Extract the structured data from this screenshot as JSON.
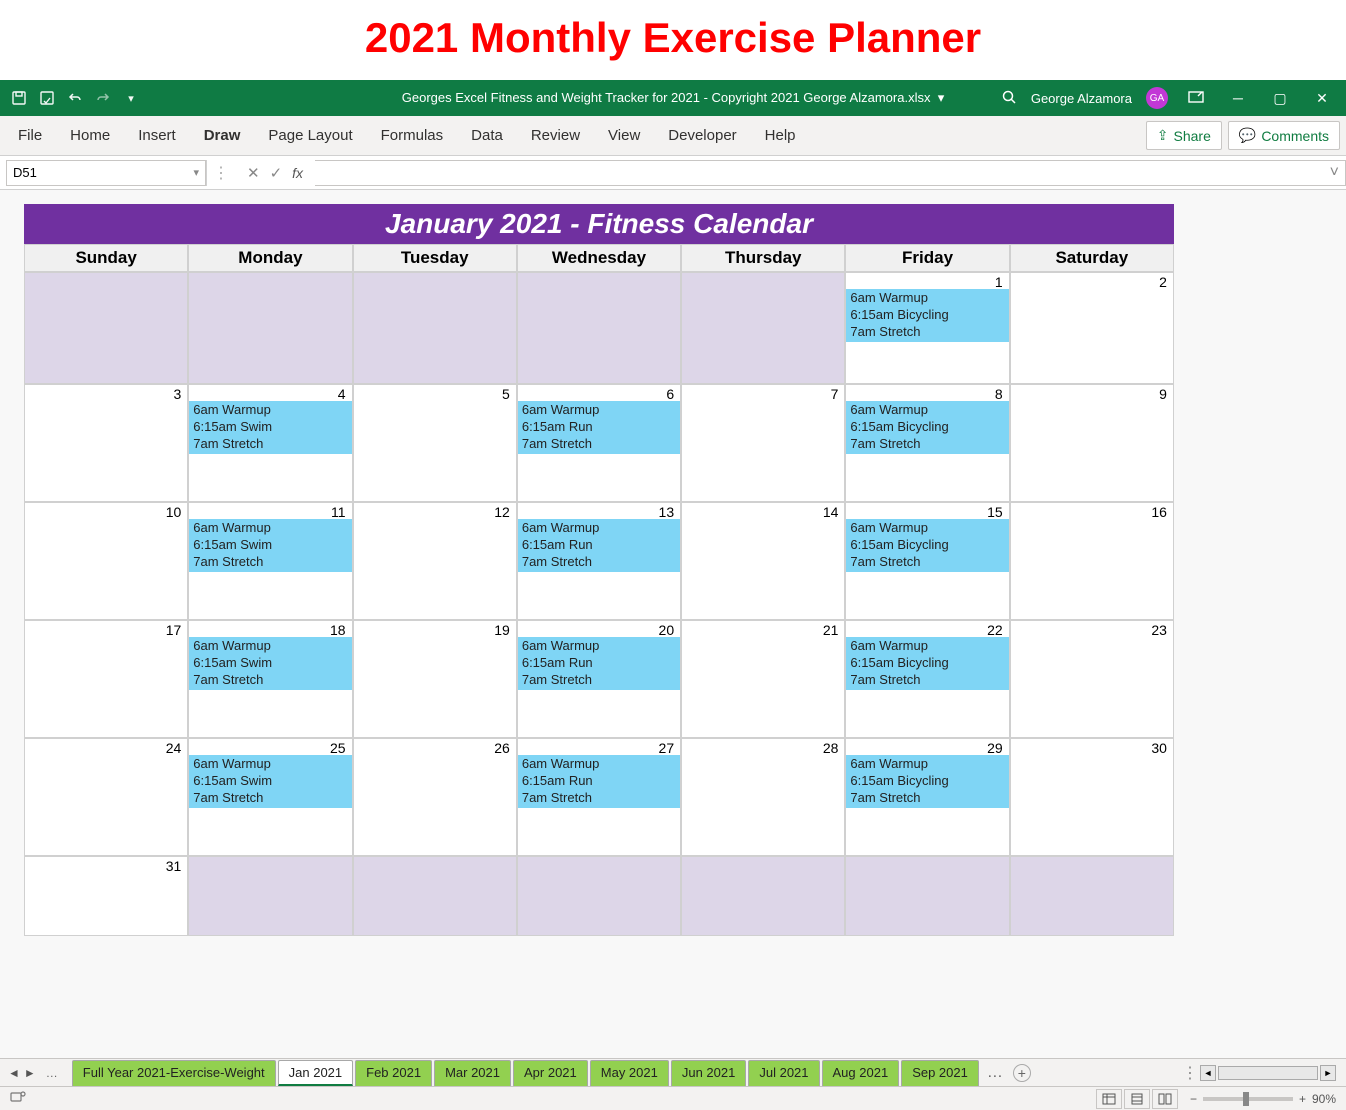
{
  "page_title": "2021 Monthly Exercise Planner",
  "title_bar": {
    "filename": "Georges Excel Fitness and Weight Tracker for 2021 - Copyright 2021 George Alzamora.xlsx",
    "user": "George Alzamora",
    "initials": "GA"
  },
  "ribbon": {
    "tabs": [
      "File",
      "Home",
      "Insert",
      "Draw",
      "Page Layout",
      "Formulas",
      "Data",
      "Review",
      "View",
      "Developer",
      "Help"
    ],
    "active": "Draw",
    "share": "Share",
    "comments": "Comments"
  },
  "name_box": "D51",
  "calendar": {
    "title": "January 2021  -  Fitness Calendar",
    "days": [
      "Sunday",
      "Monday",
      "Tuesday",
      "Wednesday",
      "Thursday",
      "Friday",
      "Saturday"
    ],
    "weeks": [
      [
        {
          "pad": true
        },
        {
          "pad": true
        },
        {
          "pad": true
        },
        {
          "pad": true
        },
        {
          "pad": true
        },
        {
          "num": "1",
          "ev": [
            "6am Warmup",
            "6:15am Bicycling",
            "7am Stretch"
          ]
        },
        {
          "num": "2"
        }
      ],
      [
        {
          "num": "3"
        },
        {
          "num": "4",
          "ev": [
            "6am Warmup",
            "6:15am Swim",
            "7am Stretch"
          ]
        },
        {
          "num": "5"
        },
        {
          "num": "6",
          "ev": [
            "6am Warmup",
            "6:15am Run",
            "7am Stretch"
          ]
        },
        {
          "num": "7"
        },
        {
          "num": "8",
          "ev": [
            "6am Warmup",
            "6:15am Bicycling",
            "7am Stretch"
          ]
        },
        {
          "num": "9"
        }
      ],
      [
        {
          "num": "10"
        },
        {
          "num": "11",
          "ev": [
            "6am Warmup",
            "6:15am Swim",
            "7am Stretch"
          ]
        },
        {
          "num": "12"
        },
        {
          "num": "13",
          "ev": [
            "6am Warmup",
            "6:15am Run",
            "7am Stretch"
          ]
        },
        {
          "num": "14"
        },
        {
          "num": "15",
          "ev": [
            "6am Warmup",
            "6:15am Bicycling",
            "7am Stretch"
          ]
        },
        {
          "num": "16"
        }
      ],
      [
        {
          "num": "17"
        },
        {
          "num": "18",
          "ev": [
            "6am Warmup",
            "6:15am Swim",
            "7am Stretch"
          ]
        },
        {
          "num": "19"
        },
        {
          "num": "20",
          "ev": [
            "6am Warmup",
            "6:15am Run",
            "7am Stretch"
          ]
        },
        {
          "num": "21"
        },
        {
          "num": "22",
          "ev": [
            "6am Warmup",
            "6:15am Bicycling",
            "7am Stretch"
          ]
        },
        {
          "num": "23"
        }
      ],
      [
        {
          "num": "24"
        },
        {
          "num": "25",
          "ev": [
            "6am Warmup",
            "6:15am Swim",
            "7am Stretch"
          ]
        },
        {
          "num": "26"
        },
        {
          "num": "27",
          "ev": [
            "6am Warmup",
            "6:15am Run",
            "7am Stretch"
          ]
        },
        {
          "num": "28"
        },
        {
          "num": "29",
          "ev": [
            "6am Warmup",
            "6:15am Bicycling",
            "7am Stretch"
          ]
        },
        {
          "num": "30"
        }
      ],
      [
        {
          "num": "31"
        },
        {
          "pad": true
        },
        {
          "pad": true
        },
        {
          "pad": true
        },
        {
          "pad": true
        },
        {
          "pad": true
        },
        {
          "pad": true
        }
      ]
    ]
  },
  "sheets": [
    "Full Year 2021-Exercise-Weight",
    "Jan 2021",
    "Feb 2021",
    "Mar 2021",
    "Apr 2021",
    "May 2021",
    "Jun 2021",
    "Jul 2021",
    "Aug 2021",
    "Sep 2021"
  ],
  "active_sheet": "Jan 2021",
  "zoom": "90%"
}
